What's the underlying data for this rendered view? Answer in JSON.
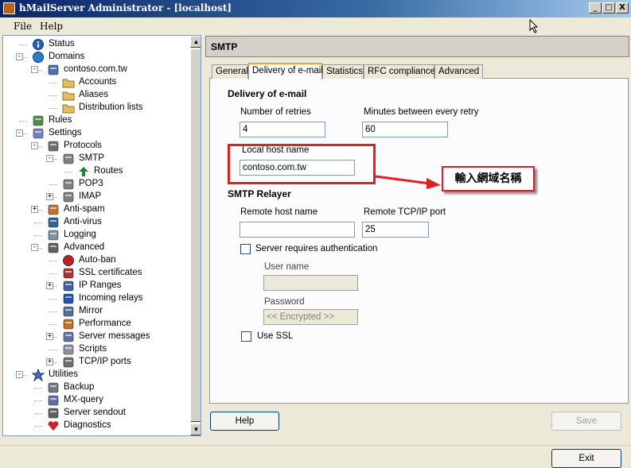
{
  "window": {
    "title": "hMailServer Administrator - [localhost]",
    "controls": [
      "_",
      "□",
      "X"
    ]
  },
  "menu": [
    "File",
    "Help"
  ],
  "tree": [
    {
      "label": "Status",
      "icon": "info-icon",
      "level": 1,
      "expander": ""
    },
    {
      "label": "Domains",
      "icon": "globe-icon",
      "level": 1,
      "expander": "−"
    },
    {
      "label": "contoso.com.tw",
      "icon": "server-icon",
      "level": 2,
      "expander": "−"
    },
    {
      "label": "Accounts",
      "icon": "folder-icon",
      "level": 3,
      "expander": ""
    },
    {
      "label": "Aliases",
      "icon": "folder-icon",
      "level": 3,
      "expander": ""
    },
    {
      "label": "Distribution lists",
      "icon": "folder-icon",
      "level": 3,
      "expander": ""
    },
    {
      "label": "Rules",
      "icon": "rules-icon",
      "level": 1,
      "expander": ""
    },
    {
      "label": "Settings",
      "icon": "settings-icon",
      "level": 1,
      "expander": "−"
    },
    {
      "label": "Protocols",
      "icon": "protocols-icon",
      "level": 2,
      "expander": "−"
    },
    {
      "label": "SMTP",
      "icon": "protocol-icon",
      "level": 3,
      "expander": "−"
    },
    {
      "label": "Routes",
      "icon": "route-icon",
      "level": 4,
      "expander": ""
    },
    {
      "label": "POP3",
      "icon": "protocol-icon",
      "level": 3,
      "expander": ""
    },
    {
      "label": "IMAP",
      "icon": "protocol-icon",
      "level": 3,
      "expander": "+"
    },
    {
      "label": "Anti-spam",
      "icon": "antispam-icon",
      "level": 2,
      "expander": "+"
    },
    {
      "label": "Anti-virus",
      "icon": "antivirus-icon",
      "level": 2,
      "expander": ""
    },
    {
      "label": "Logging",
      "icon": "logging-icon",
      "level": 2,
      "expander": ""
    },
    {
      "label": "Advanced",
      "icon": "advanced-icon",
      "level": 2,
      "expander": "−"
    },
    {
      "label": "Auto-ban",
      "icon": "autoban-icon",
      "level": 3,
      "expander": ""
    },
    {
      "label": "SSL certificates",
      "icon": "certificate-icon",
      "level": 3,
      "expander": ""
    },
    {
      "label": "IP Ranges",
      "icon": "ip-ranges-icon",
      "level": 3,
      "expander": "+"
    },
    {
      "label": "Incoming relays",
      "icon": "relay-icon",
      "level": 3,
      "expander": ""
    },
    {
      "label": "Mirror",
      "icon": "mirror-icon",
      "level": 3,
      "expander": ""
    },
    {
      "label": "Performance",
      "icon": "performance-icon",
      "level": 3,
      "expander": ""
    },
    {
      "label": "Server messages",
      "icon": "messages-icon",
      "level": 3,
      "expander": "+"
    },
    {
      "label": "Scripts",
      "icon": "scripts-icon",
      "level": 3,
      "expander": ""
    },
    {
      "label": "TCP/IP ports",
      "icon": "ports-icon",
      "level": 3,
      "expander": "+"
    },
    {
      "label": "Utilities",
      "icon": "star-icon",
      "level": 1,
      "expander": "−"
    },
    {
      "label": "Backup",
      "icon": "backup-icon",
      "level": 2,
      "expander": ""
    },
    {
      "label": "MX-query",
      "icon": "mx-query-icon",
      "level": 2,
      "expander": ""
    },
    {
      "label": "Server sendout",
      "icon": "sendout-icon",
      "level": 2,
      "expander": ""
    },
    {
      "label": "Diagnostics",
      "icon": "diagnostics-icon",
      "level": 2,
      "expander": ""
    }
  ],
  "panel": {
    "title": "SMTP",
    "tabs": [
      "General",
      "Delivery of e-mail",
      "Statistics",
      "RFC compliance",
      "Advanced"
    ],
    "active_tab": 1,
    "delivery_title": "Delivery of e-mail",
    "retries_label": "Number of retries",
    "retries_value": "4",
    "minutes_label": "Minutes between every retry",
    "minutes_value": "60",
    "local_host_label": "Local host name",
    "local_host_value": "contoso.com.tw",
    "relayer_title": "SMTP Relayer",
    "remote_host_label": "Remote host name",
    "remote_host_value": "",
    "remote_port_label": "Remote TCP/IP port",
    "remote_port_value": "25",
    "auth_label": "Server requires authentication",
    "username_label": "User name",
    "username_value": "",
    "password_label": "Password",
    "password_value": "<< Encrypted >>",
    "ssl_label": "Use SSL"
  },
  "annotation": {
    "callout_text": "輸入網域名稱",
    "color": "#e02020"
  },
  "buttons": {
    "help": "Help",
    "save": "Save",
    "exit": "Exit"
  }
}
